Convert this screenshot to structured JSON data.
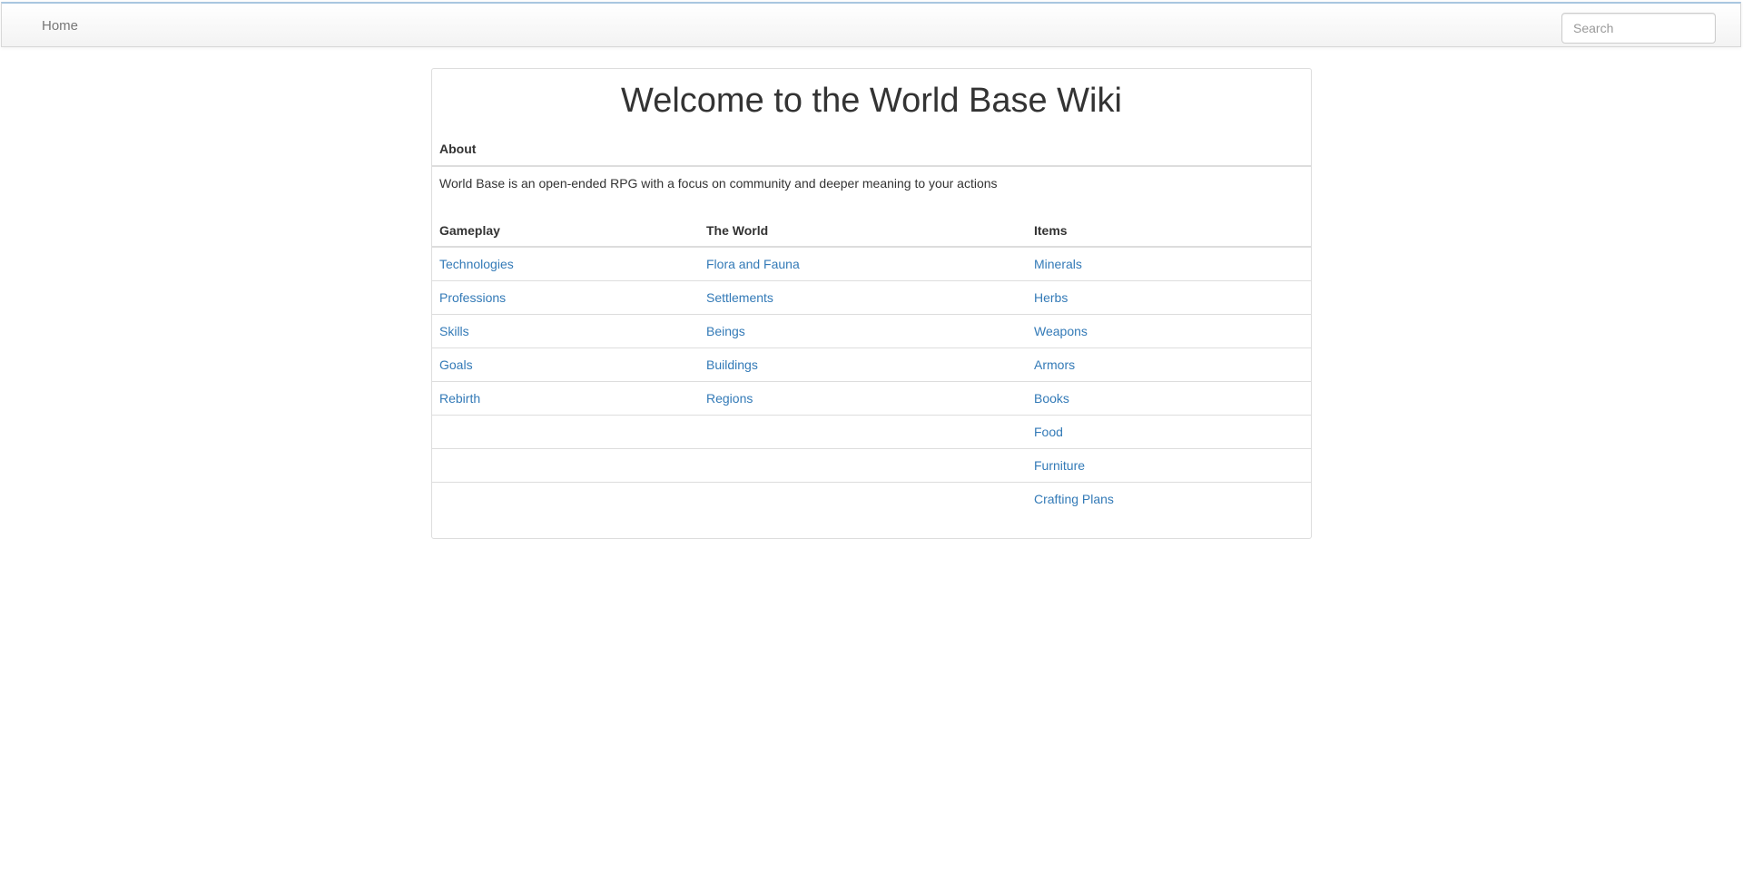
{
  "nav": {
    "home_label": "Home",
    "search_placeholder": "Search"
  },
  "page": {
    "title": "Welcome to the World Base Wiki",
    "about_heading": "About",
    "about_text": "World Base is an open-ended RPG with a focus on community and deeper meaning to your actions"
  },
  "table": {
    "headers": [
      "Gameplay",
      "The World",
      "Items"
    ],
    "rows": [
      [
        "Technologies",
        "Flora and Fauna",
        "Minerals"
      ],
      [
        "Professions",
        "Settlements",
        "Herbs"
      ],
      [
        "Skills",
        "Beings",
        "Weapons"
      ],
      [
        "Goals",
        "Buildings",
        "Armors"
      ],
      [
        "Rebirth",
        "Regions",
        "Books"
      ],
      [
        "",
        "",
        "Food"
      ],
      [
        "",
        "",
        "Furniture"
      ],
      [
        "",
        "",
        "Crafting Plans"
      ]
    ]
  },
  "colors": {
    "link": "#337ab7",
    "text": "#333333",
    "border": "#dddddd"
  }
}
